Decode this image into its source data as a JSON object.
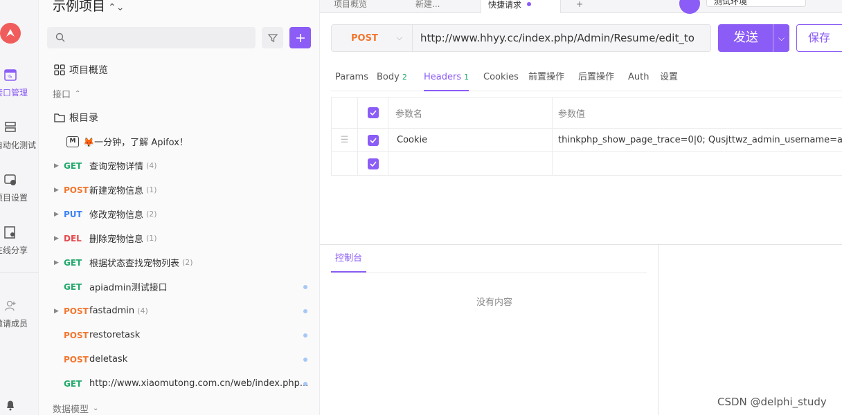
{
  "rail": {
    "items": [
      {
        "label": "接口管理",
        "active": true
      },
      {
        "label": "自动化测试"
      },
      {
        "label": "项目设置"
      },
      {
        "label": "在线分享"
      },
      {
        "label": "邀请成员"
      }
    ]
  },
  "sidebar": {
    "project_title": "示例项目",
    "search_placeholder": "",
    "overview": "项目概览",
    "section": "接口",
    "root": "根目录",
    "doc_item": "🦊一分钟，了解 Apifox！",
    "items": [
      {
        "method": "GET",
        "name": "查询宠物详情",
        "count": "(4)",
        "arrow": true,
        "dot": false
      },
      {
        "method": "POST",
        "name": "新建宠物信息",
        "count": "(1)",
        "arrow": true,
        "dot": false
      },
      {
        "method": "PUT",
        "name": "修改宠物信息",
        "count": "(2)",
        "arrow": true,
        "dot": false
      },
      {
        "method": "DEL",
        "name": "删除宠物信息",
        "count": "(1)",
        "arrow": true,
        "dot": false
      },
      {
        "method": "GET",
        "name": "根据状态查找宠物列表",
        "count": "(2)",
        "arrow": true,
        "dot": false
      },
      {
        "method": "GET",
        "name": "apiadmin测试接口",
        "count": "",
        "arrow": false,
        "dot": true
      },
      {
        "method": "POST",
        "name": "fastadmin",
        "count": "(4)",
        "arrow": true,
        "dot": true
      },
      {
        "method": "POST",
        "name": "restoretask",
        "count": "",
        "arrow": false,
        "dot": true
      },
      {
        "method": "POST",
        "name": "deletask",
        "count": "",
        "arrow": false,
        "dot": true
      },
      {
        "method": "GET",
        "name": "http://www.xiaomutong.com.cn/web/index.php...",
        "count": "",
        "arrow": false,
        "dot": true
      }
    ],
    "data_model": "数据模型"
  },
  "tabs": [
    {
      "label": "项目概览"
    },
    {
      "label": "新建..."
    },
    {
      "label": "快捷请求",
      "active": true
    },
    {
      "label": "+"
    }
  ],
  "env_label": "测试环境",
  "request": {
    "method": "POST",
    "url": "http://www.hhyy.cc/index.php/Admin/Resume/edit_to",
    "send_label": "发送",
    "save_label": "保存"
  },
  "subtabs": [
    {
      "label": "Params",
      "badge": ""
    },
    {
      "label": "Body",
      "badge": "2"
    },
    {
      "label": "Headers",
      "badge": "1",
      "active": true
    },
    {
      "label": "Cookies",
      "badge": ""
    },
    {
      "label": "前置操作",
      "badge": ""
    },
    {
      "label": "后置操作",
      "badge": ""
    },
    {
      "label": "Auth",
      "badge": ""
    },
    {
      "label": "设置",
      "badge": ""
    }
  ],
  "headers_table": {
    "col_name": "参数名",
    "col_value": "参数值",
    "rows": [
      {
        "name": "Cookie",
        "value": "thinkphp_show_page_trace=0|0; Qusjttwz_admin_username=a"
      },
      {
        "name": "",
        "value": ""
      }
    ]
  },
  "console": {
    "tab": "控制台",
    "empty": "没有内容"
  },
  "watermark": "CSDN @delphi_study",
  "colors": {
    "accent": "#8b5cf6",
    "get": "#22a86b",
    "post": "#f2762e",
    "put": "#3b82f6",
    "del": "#e5484d"
  }
}
